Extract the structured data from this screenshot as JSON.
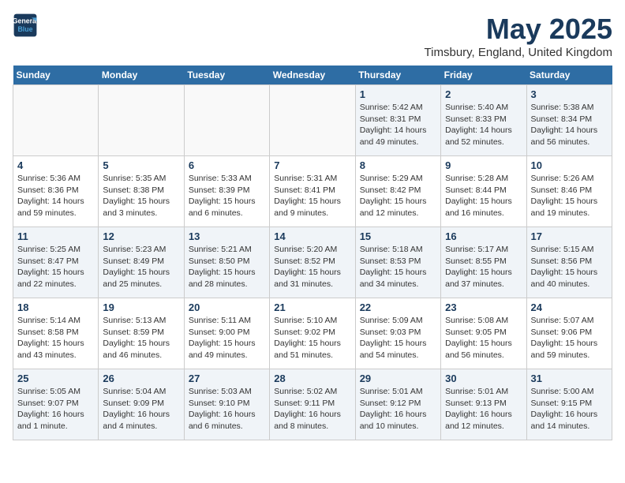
{
  "header": {
    "logo_line1": "General",
    "logo_line2": "Blue",
    "month_title": "May 2025",
    "location": "Timsbury, England, United Kingdom"
  },
  "weekdays": [
    "Sunday",
    "Monday",
    "Tuesday",
    "Wednesday",
    "Thursday",
    "Friday",
    "Saturday"
  ],
  "weeks": [
    [
      {
        "day": "",
        "info": ""
      },
      {
        "day": "",
        "info": ""
      },
      {
        "day": "",
        "info": ""
      },
      {
        "day": "",
        "info": ""
      },
      {
        "day": "1",
        "info": "Sunrise: 5:42 AM\nSunset: 8:31 PM\nDaylight: 14 hours\nand 49 minutes."
      },
      {
        "day": "2",
        "info": "Sunrise: 5:40 AM\nSunset: 8:33 PM\nDaylight: 14 hours\nand 52 minutes."
      },
      {
        "day": "3",
        "info": "Sunrise: 5:38 AM\nSunset: 8:34 PM\nDaylight: 14 hours\nand 56 minutes."
      }
    ],
    [
      {
        "day": "4",
        "info": "Sunrise: 5:36 AM\nSunset: 8:36 PM\nDaylight: 14 hours\nand 59 minutes."
      },
      {
        "day": "5",
        "info": "Sunrise: 5:35 AM\nSunset: 8:38 PM\nDaylight: 15 hours\nand 3 minutes."
      },
      {
        "day": "6",
        "info": "Sunrise: 5:33 AM\nSunset: 8:39 PM\nDaylight: 15 hours\nand 6 minutes."
      },
      {
        "day": "7",
        "info": "Sunrise: 5:31 AM\nSunset: 8:41 PM\nDaylight: 15 hours\nand 9 minutes."
      },
      {
        "day": "8",
        "info": "Sunrise: 5:29 AM\nSunset: 8:42 PM\nDaylight: 15 hours\nand 12 minutes."
      },
      {
        "day": "9",
        "info": "Sunrise: 5:28 AM\nSunset: 8:44 PM\nDaylight: 15 hours\nand 16 minutes."
      },
      {
        "day": "10",
        "info": "Sunrise: 5:26 AM\nSunset: 8:46 PM\nDaylight: 15 hours\nand 19 minutes."
      }
    ],
    [
      {
        "day": "11",
        "info": "Sunrise: 5:25 AM\nSunset: 8:47 PM\nDaylight: 15 hours\nand 22 minutes."
      },
      {
        "day": "12",
        "info": "Sunrise: 5:23 AM\nSunset: 8:49 PM\nDaylight: 15 hours\nand 25 minutes."
      },
      {
        "day": "13",
        "info": "Sunrise: 5:21 AM\nSunset: 8:50 PM\nDaylight: 15 hours\nand 28 minutes."
      },
      {
        "day": "14",
        "info": "Sunrise: 5:20 AM\nSunset: 8:52 PM\nDaylight: 15 hours\nand 31 minutes."
      },
      {
        "day": "15",
        "info": "Sunrise: 5:18 AM\nSunset: 8:53 PM\nDaylight: 15 hours\nand 34 minutes."
      },
      {
        "day": "16",
        "info": "Sunrise: 5:17 AM\nSunset: 8:55 PM\nDaylight: 15 hours\nand 37 minutes."
      },
      {
        "day": "17",
        "info": "Sunrise: 5:15 AM\nSunset: 8:56 PM\nDaylight: 15 hours\nand 40 minutes."
      }
    ],
    [
      {
        "day": "18",
        "info": "Sunrise: 5:14 AM\nSunset: 8:58 PM\nDaylight: 15 hours\nand 43 minutes."
      },
      {
        "day": "19",
        "info": "Sunrise: 5:13 AM\nSunset: 8:59 PM\nDaylight: 15 hours\nand 46 minutes."
      },
      {
        "day": "20",
        "info": "Sunrise: 5:11 AM\nSunset: 9:00 PM\nDaylight: 15 hours\nand 49 minutes."
      },
      {
        "day": "21",
        "info": "Sunrise: 5:10 AM\nSunset: 9:02 PM\nDaylight: 15 hours\nand 51 minutes."
      },
      {
        "day": "22",
        "info": "Sunrise: 5:09 AM\nSunset: 9:03 PM\nDaylight: 15 hours\nand 54 minutes."
      },
      {
        "day": "23",
        "info": "Sunrise: 5:08 AM\nSunset: 9:05 PM\nDaylight: 15 hours\nand 56 minutes."
      },
      {
        "day": "24",
        "info": "Sunrise: 5:07 AM\nSunset: 9:06 PM\nDaylight: 15 hours\nand 59 minutes."
      }
    ],
    [
      {
        "day": "25",
        "info": "Sunrise: 5:05 AM\nSunset: 9:07 PM\nDaylight: 16 hours\nand 1 minute."
      },
      {
        "day": "26",
        "info": "Sunrise: 5:04 AM\nSunset: 9:09 PM\nDaylight: 16 hours\nand 4 minutes."
      },
      {
        "day": "27",
        "info": "Sunrise: 5:03 AM\nSunset: 9:10 PM\nDaylight: 16 hours\nand 6 minutes."
      },
      {
        "day": "28",
        "info": "Sunrise: 5:02 AM\nSunset: 9:11 PM\nDaylight: 16 hours\nand 8 minutes."
      },
      {
        "day": "29",
        "info": "Sunrise: 5:01 AM\nSunset: 9:12 PM\nDaylight: 16 hours\nand 10 minutes."
      },
      {
        "day": "30",
        "info": "Sunrise: 5:01 AM\nSunset: 9:13 PM\nDaylight: 16 hours\nand 12 minutes."
      },
      {
        "day": "31",
        "info": "Sunrise: 5:00 AM\nSunset: 9:15 PM\nDaylight: 16 hours\nand 14 minutes."
      }
    ]
  ]
}
